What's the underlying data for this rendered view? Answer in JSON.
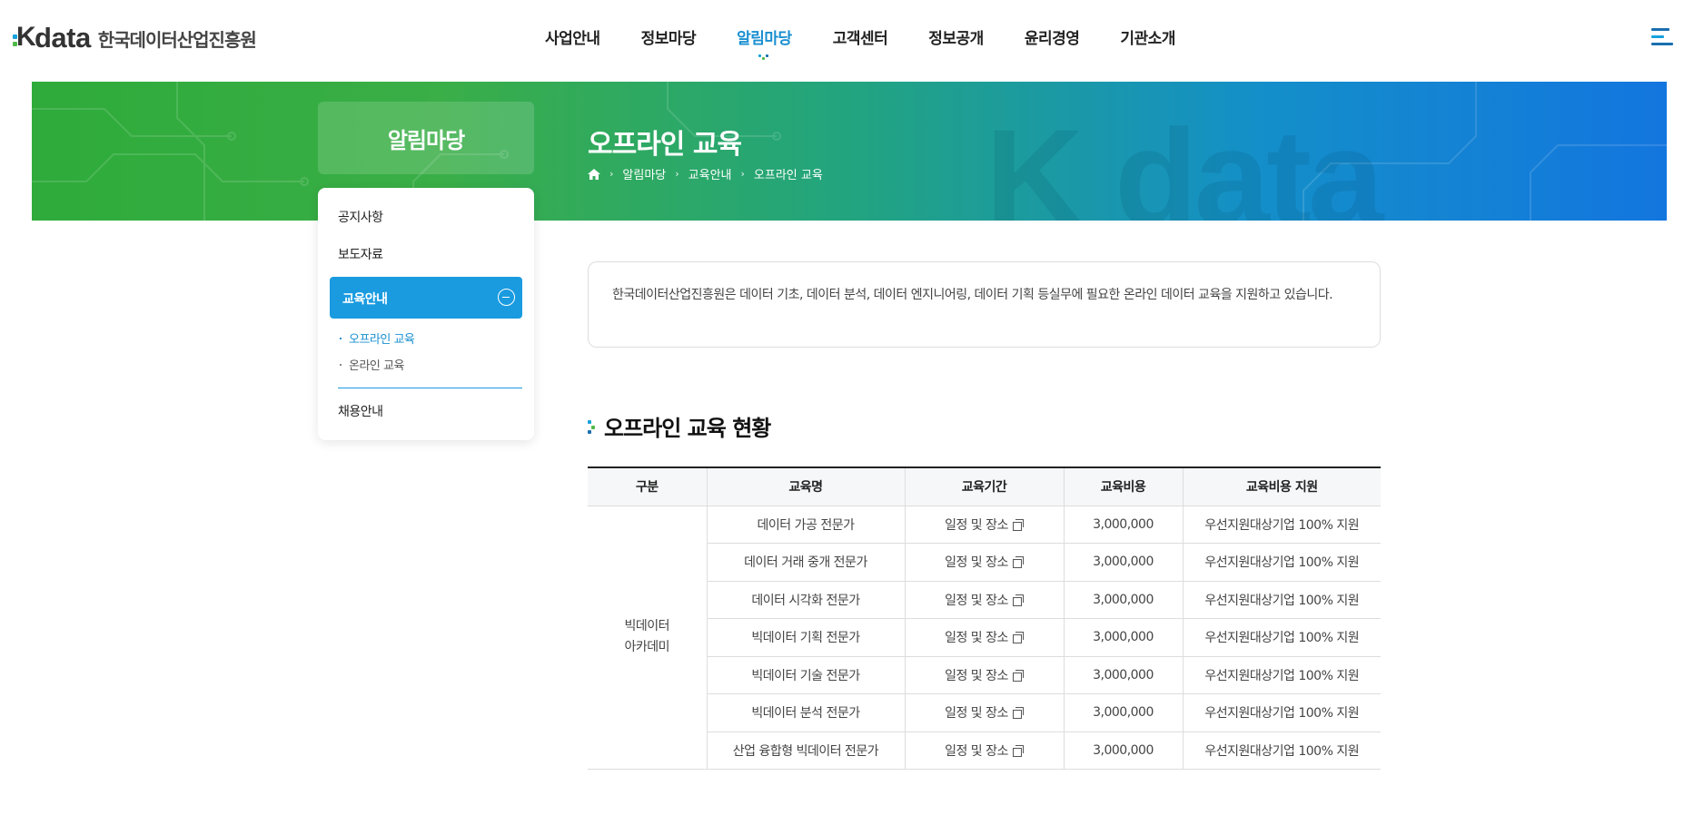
{
  "header": {
    "logo_en": "data",
    "logo_k": "K",
    "logo_ko": "한국데이터산업진흥원",
    "nav": [
      "사업안내",
      "정보마당",
      "알림마당",
      "고객센터",
      "정보공개",
      "윤리경영",
      "기관소개"
    ],
    "active_nav": "알림마당",
    "menu_icon": "hamburger-icon"
  },
  "banner": {
    "watermark": "K data",
    "title": "오프라인 교육",
    "breadcrumb": [
      "알림마당",
      "교육안내",
      "오프라인 교육"
    ]
  },
  "sidebar": {
    "title": "알림마당",
    "items": [
      {
        "label": "공지사항"
      },
      {
        "label": "보도자료"
      },
      {
        "label": "교육안내",
        "active": true
      },
      {
        "label": "채용안내"
      }
    ],
    "sub_items": [
      {
        "label": "오프라인 교육",
        "active": true
      },
      {
        "label": "온라인 교육"
      }
    ]
  },
  "intro_text": "한국데이터산업진흥원은 데이터 기초, 데이터 분석, 데이터 엔지니어링, 데이터 기획 등실무에 필요한 온라인 데이터 교육을 지원하고 있습니다.",
  "section_title": "오프라인 교육 현황",
  "table": {
    "headers": [
      "구분",
      "교육명",
      "교육기간",
      "교육비용",
      "교육비용 지원"
    ],
    "category_line1": "빅데이터",
    "category_line2": "아카데미",
    "rows": [
      {
        "name": "데이터 가공 전문가",
        "period": "일정 및 장소",
        "cost": "3,000,000",
        "support": "우선지원대상기업 100% 지원"
      },
      {
        "name": "데이터 거래 중개 전문가",
        "period": "일정 및 장소",
        "cost": "3,000,000",
        "support": "우선지원대상기업 100% 지원"
      },
      {
        "name": "데이터 시각화 전문가",
        "period": "일정 및 장소",
        "cost": "3,000,000",
        "support": "우선지원대상기업 100% 지원"
      },
      {
        "name": "빅데이터 기획 전문가",
        "period": "일정 및 장소",
        "cost": "3,000,000",
        "support": "우선지원대상기업 100% 지원"
      },
      {
        "name": "빅데이터 기술 전문가",
        "period": "일정 및 장소",
        "cost": "3,000,000",
        "support": "우선지원대상기업 100% 지원"
      },
      {
        "name": "빅데이터 분석 전문가",
        "period": "일정 및 장소",
        "cost": "3,000,000",
        "support": "우선지원대상기업 100% 지원"
      },
      {
        "name": "산업 융합형 빅데이터 전문가",
        "period": "일정 및 장소",
        "cost": "3,000,000",
        "support": "우선지원대상기업 100% 지원"
      }
    ]
  },
  "colors": {
    "accent": "#1a8fd0",
    "side_active": "#1a9be0",
    "banner_start": "#2eab3a",
    "banner_end": "#1376df"
  }
}
